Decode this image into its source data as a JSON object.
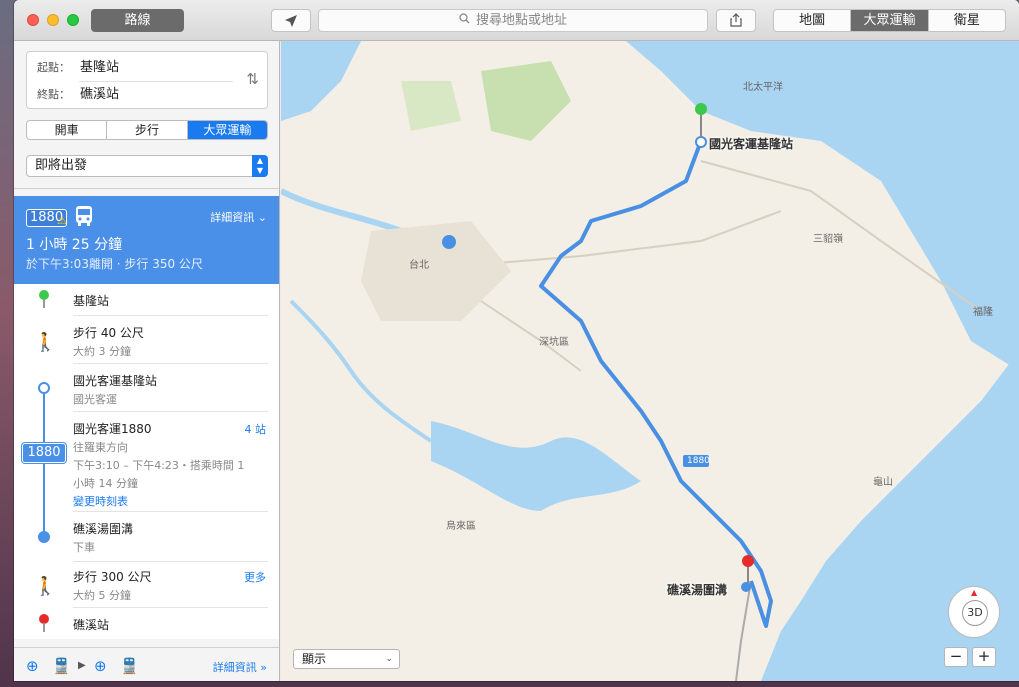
{
  "toolbar": {
    "route_label": "路線",
    "search_placeholder": "搜尋地點或地址",
    "map_modes": [
      "地圖",
      "大眾運輸",
      "衛星"
    ],
    "active_map_mode": "大眾運輸"
  },
  "sidebar": {
    "start_label": "起點：",
    "start_value": "基隆站",
    "end_label": "終點：",
    "end_value": "礁溪站",
    "transport_modes": [
      "開車",
      "步行",
      "大眾運輸"
    ],
    "active_transport_mode": "大眾運輸",
    "depart_option": "即將出發",
    "route": {
      "line_badge": "1880",
      "detail_link": "詳細資訊",
      "duration": "1 小時 25 分鐘",
      "summary": "於下午3:03離開 · 步行 350 公尺"
    },
    "steps": {
      "start_station": "基隆站",
      "walk1_title": "步行 40 公尺",
      "walk1_sub": "大約 3 分鐘",
      "board_title": "國光客運基隆站",
      "board_sub": "國光客運",
      "ride_title": "國光客運1880",
      "ride_stops": "4 站",
      "ride_direction": "往羅東方向",
      "ride_time_1": "下午3:10 – 下午4:23・搭乘時間 1",
      "ride_time_2": "小時 14 分鐘",
      "ride_change_link": "變更時刻表",
      "alight_title": "礁溪湯圍溝",
      "alight_sub": "下車",
      "walk2_title": "步行 300 公尺",
      "walk2_more": "更多",
      "walk2_sub": "大約 5 分鐘",
      "end_station": "礁溪站",
      "line_badge": "1880"
    },
    "bottom_detail": "詳細資訊 »"
  },
  "map": {
    "labels": {
      "north_pacific": "北太平洋",
      "taipei": "台北",
      "shenkeng": "深坑區",
      "wulai": "烏來區",
      "sandiaoling": "三貂嶺",
      "fulong": "福隆",
      "guishan": "龜山",
      "route_shield": "1880"
    },
    "origin_stop": "國光客運基隆站",
    "destination_stop": "礁溪湯圍溝",
    "show_select": "顯示",
    "compass_label": "3D",
    "zoom_out": "−",
    "zoom_in": "+"
  },
  "colors": {
    "accent": "#1a7bf0",
    "route_card": "#4a8fe8",
    "route_line": "#4a90e2",
    "water": "#a9d4f2",
    "land": "#f3efe6",
    "park": "#c8e0b0"
  }
}
